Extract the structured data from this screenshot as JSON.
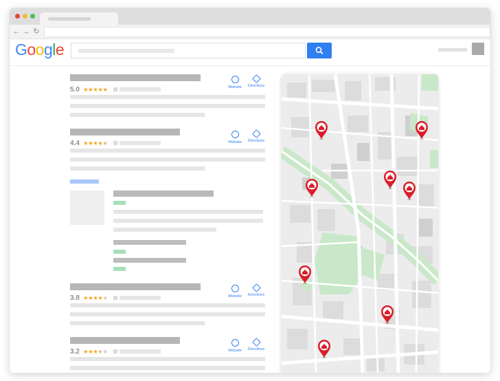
{
  "browser": {
    "traffic_lights": {
      "close": "#e8463c",
      "minimize": "#f0ba2c",
      "zoom": "#4cc24a"
    },
    "nav": {
      "back": "←",
      "forward": "→",
      "reload": "↻"
    }
  },
  "google": {
    "logo_letters": [
      {
        "ch": "G",
        "color": "#4285F4"
      },
      {
        "ch": "o",
        "color": "#EA4335"
      },
      {
        "ch": "o",
        "color": "#FBBC05"
      },
      {
        "ch": "g",
        "color": "#4285F4"
      },
      {
        "ch": "l",
        "color": "#34A853"
      },
      {
        "ch": "e",
        "color": "#EA4335"
      }
    ],
    "search_button_color": "#2f7ff0"
  },
  "results": [
    {
      "rating": "5.0",
      "stars": 5,
      "website_label": "Website",
      "directions_label": "Directions"
    },
    {
      "rating": "4.4",
      "stars": 4.5,
      "website_label": "Website",
      "directions_label": "Directions"
    },
    {
      "rating": "3.8",
      "stars": 4,
      "website_label": "Website",
      "directions_label": "Directions"
    },
    {
      "rating": "3.2",
      "stars": 3.5,
      "website_label": "Website",
      "directions_label": "Directions"
    }
  ],
  "map": {
    "pin_color": "#d81f2a",
    "park_color": "#c9e8c9",
    "pin_count": 8
  }
}
